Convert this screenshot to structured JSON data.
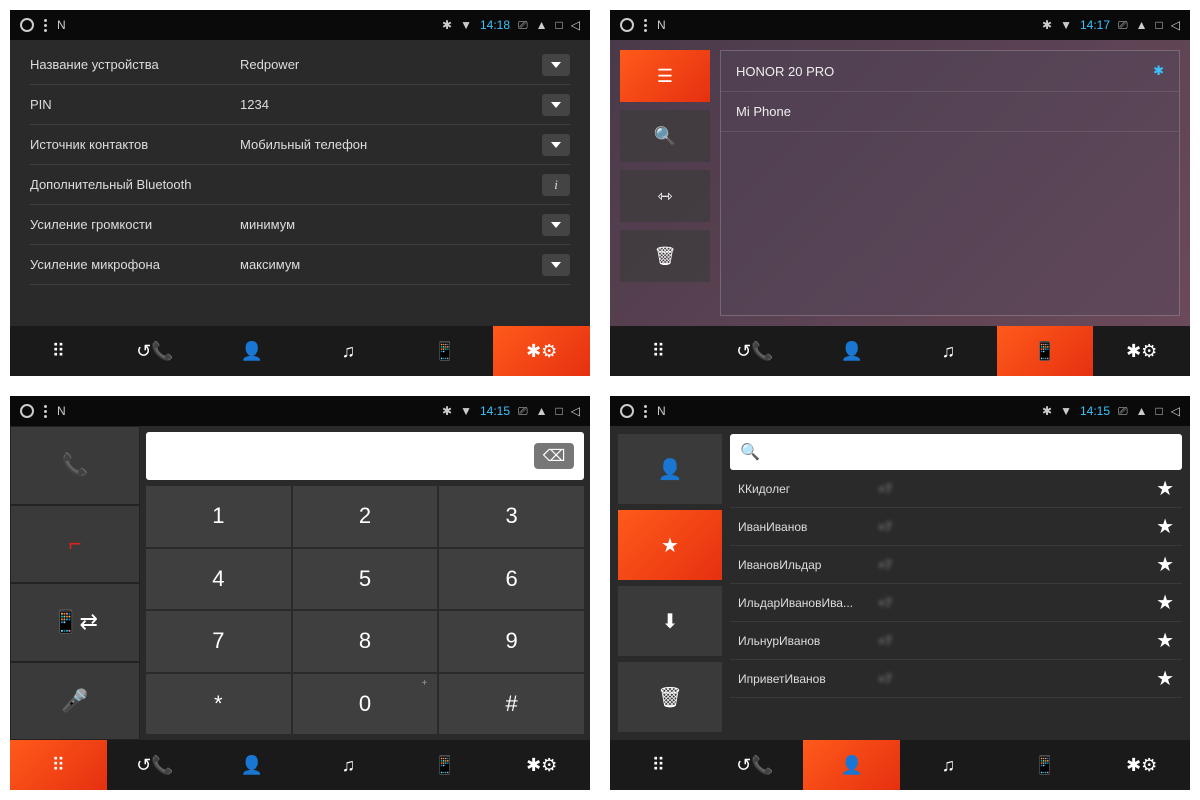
{
  "statusbar": {
    "n_label": "N",
    "bt_icon": "✱",
    "wifi_icon": "▾",
    "cast_icon": "⎚",
    "eject_icon": "▲",
    "square_icon": "□",
    "back_icon": "◁"
  },
  "screens": {
    "s1": {
      "time": "14:18",
      "settings": [
        {
          "label": "Название устройства",
          "value": "Redpower",
          "type": "dropdown"
        },
        {
          "label": "PIN",
          "value": "1234",
          "type": "dropdown"
        },
        {
          "label": "Источник контактов",
          "value": "Мобильный телефон",
          "type": "dropdown"
        },
        {
          "label": "Дополнительный Bluetooth",
          "value": "",
          "type": "info"
        },
        {
          "label": "Усиление громкости",
          "value": "минимум",
          "type": "dropdown"
        },
        {
          "label": "Усиление микрофона",
          "value": "максимум",
          "type": "dropdown"
        }
      ],
      "nav_active": 5
    },
    "s2": {
      "time": "14:17",
      "devices": [
        {
          "name": "HONOR 20 PRO",
          "connected": true
        },
        {
          "name": "Mi Phone",
          "connected": false
        }
      ],
      "side_active": 0,
      "nav_active": 4
    },
    "s3": {
      "time": "14:15",
      "keys": [
        "1",
        "2",
        "3",
        "4",
        "5",
        "6",
        "7",
        "8",
        "9",
        "*",
        "0",
        "#"
      ],
      "nav_active": 0
    },
    "s4": {
      "time": "14:15",
      "contacts": [
        {
          "name": "ККидолег",
          "phone": "+7"
        },
        {
          "name": "ИванИванов",
          "phone": "+7"
        },
        {
          "name": "ИвановИльдар",
          "phone": "+7"
        },
        {
          "name": "ИльдарИвановИва...",
          "phone": "+7"
        },
        {
          "name": "ИльнурИванов",
          "phone": "+7"
        },
        {
          "name": "ИприветИванов",
          "phone": "+7"
        }
      ],
      "side_active": 1,
      "nav_active": 2
    }
  },
  "nav_icons": [
    "keypad",
    "call-history",
    "contacts",
    "music",
    "bt-device",
    "bt-settings"
  ]
}
